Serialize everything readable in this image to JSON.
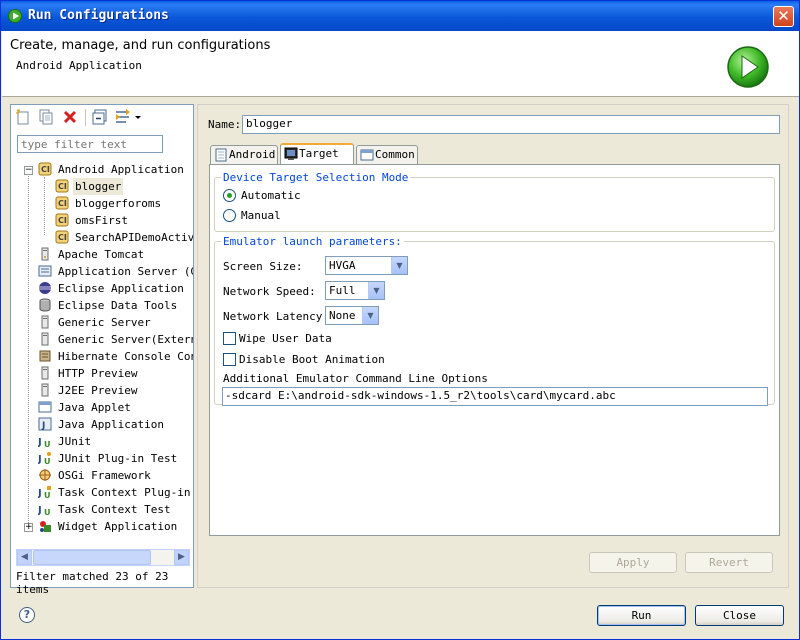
{
  "window": {
    "title": "Run Configurations",
    "close_glyph": "✕"
  },
  "header": {
    "title": "Create, manage, and run configurations",
    "subtitle": "Android Application",
    "icon": "run-icon"
  },
  "left": {
    "toolbar": [
      "new-config-icon",
      "duplicate-icon",
      "delete-icon",
      "collapse-all-icon",
      "filter-icon",
      "dropdown-arrow-icon"
    ],
    "filter_placeholder": "type filter text",
    "tree": [
      {
        "label": "Android Application",
        "icon": "android-app-icon",
        "expander": "−"
      },
      {
        "label": "blogger",
        "icon": "android-config-icon",
        "selected": true
      },
      {
        "label": "bloggerforoms",
        "icon": "android-config-icon"
      },
      {
        "label": "omsFirst",
        "icon": "android-config-icon"
      },
      {
        "label": "SearchAPIDemoActivi",
        "icon": "android-config-icon"
      },
      {
        "label": "Apache Tomcat",
        "icon": "tomcat-icon"
      },
      {
        "label": "Application Server (Gl",
        "icon": "app-server-icon"
      },
      {
        "label": "Eclipse Application",
        "icon": "eclipse-icon"
      },
      {
        "label": "Eclipse Data Tools",
        "icon": "database-icon"
      },
      {
        "label": "Generic Server",
        "icon": "server-icon"
      },
      {
        "label": "Generic Server(Externa",
        "icon": "server-icon"
      },
      {
        "label": "Hibernate Console Conf",
        "icon": "hibernate-icon"
      },
      {
        "label": "HTTP Preview",
        "icon": "server-icon"
      },
      {
        "label": "J2EE Preview",
        "icon": "server-icon"
      },
      {
        "label": "Java Applet",
        "icon": "applet-icon"
      },
      {
        "label": "Java Application",
        "icon": "java-app-icon"
      },
      {
        "label": "JUnit",
        "icon": "junit-icon"
      },
      {
        "label": "JUnit Plug-in Test",
        "icon": "junit-plugin-icon"
      },
      {
        "label": "OSGi Framework",
        "icon": "osgi-icon"
      },
      {
        "label": "Task Context Plug-in T",
        "icon": "task-context-plugin-icon"
      },
      {
        "label": "Task Context Test",
        "icon": "task-context-icon"
      },
      {
        "label": "Widget Application",
        "icon": "widget-icon",
        "expander": "+"
      }
    ],
    "status": "Filter matched 23 of 23 items"
  },
  "right": {
    "name_label": "Name:",
    "name_value": "blogger",
    "tabs": [
      {
        "label": "Android",
        "icon": "android-tab-icon"
      },
      {
        "label": "Target",
        "icon": "target-tab-icon",
        "active": true
      },
      {
        "label": "Common",
        "icon": "common-tab-icon"
      }
    ],
    "device_group": {
      "title": "Device Target Selection Mode",
      "automatic": "Automatic",
      "manual": "Manual",
      "selected": "Automatic"
    },
    "emulator_group": {
      "title": "Emulator launch parameters:",
      "screen_size_label": "Screen Size:",
      "screen_size_value": "HVGA",
      "network_speed_label": "Network Speed:",
      "network_speed_value": "Full",
      "network_latency_label": "Network Latency:",
      "network_latency_value": "None",
      "wipe_label": "Wipe User Data",
      "wipe_checked": false,
      "disable_boot_label": "Disable Boot Animation",
      "disable_boot_checked": false,
      "cmd_label": "Additional Emulator Command Line Options",
      "cmd_value": "-sdcard E:\\android-sdk-windows-1.5_r2\\tools\\card\\mycard.abc"
    },
    "apply": "Apply",
    "revert": "Revert"
  },
  "footer": {
    "help": "?",
    "run": "Run",
    "close": "Close"
  }
}
